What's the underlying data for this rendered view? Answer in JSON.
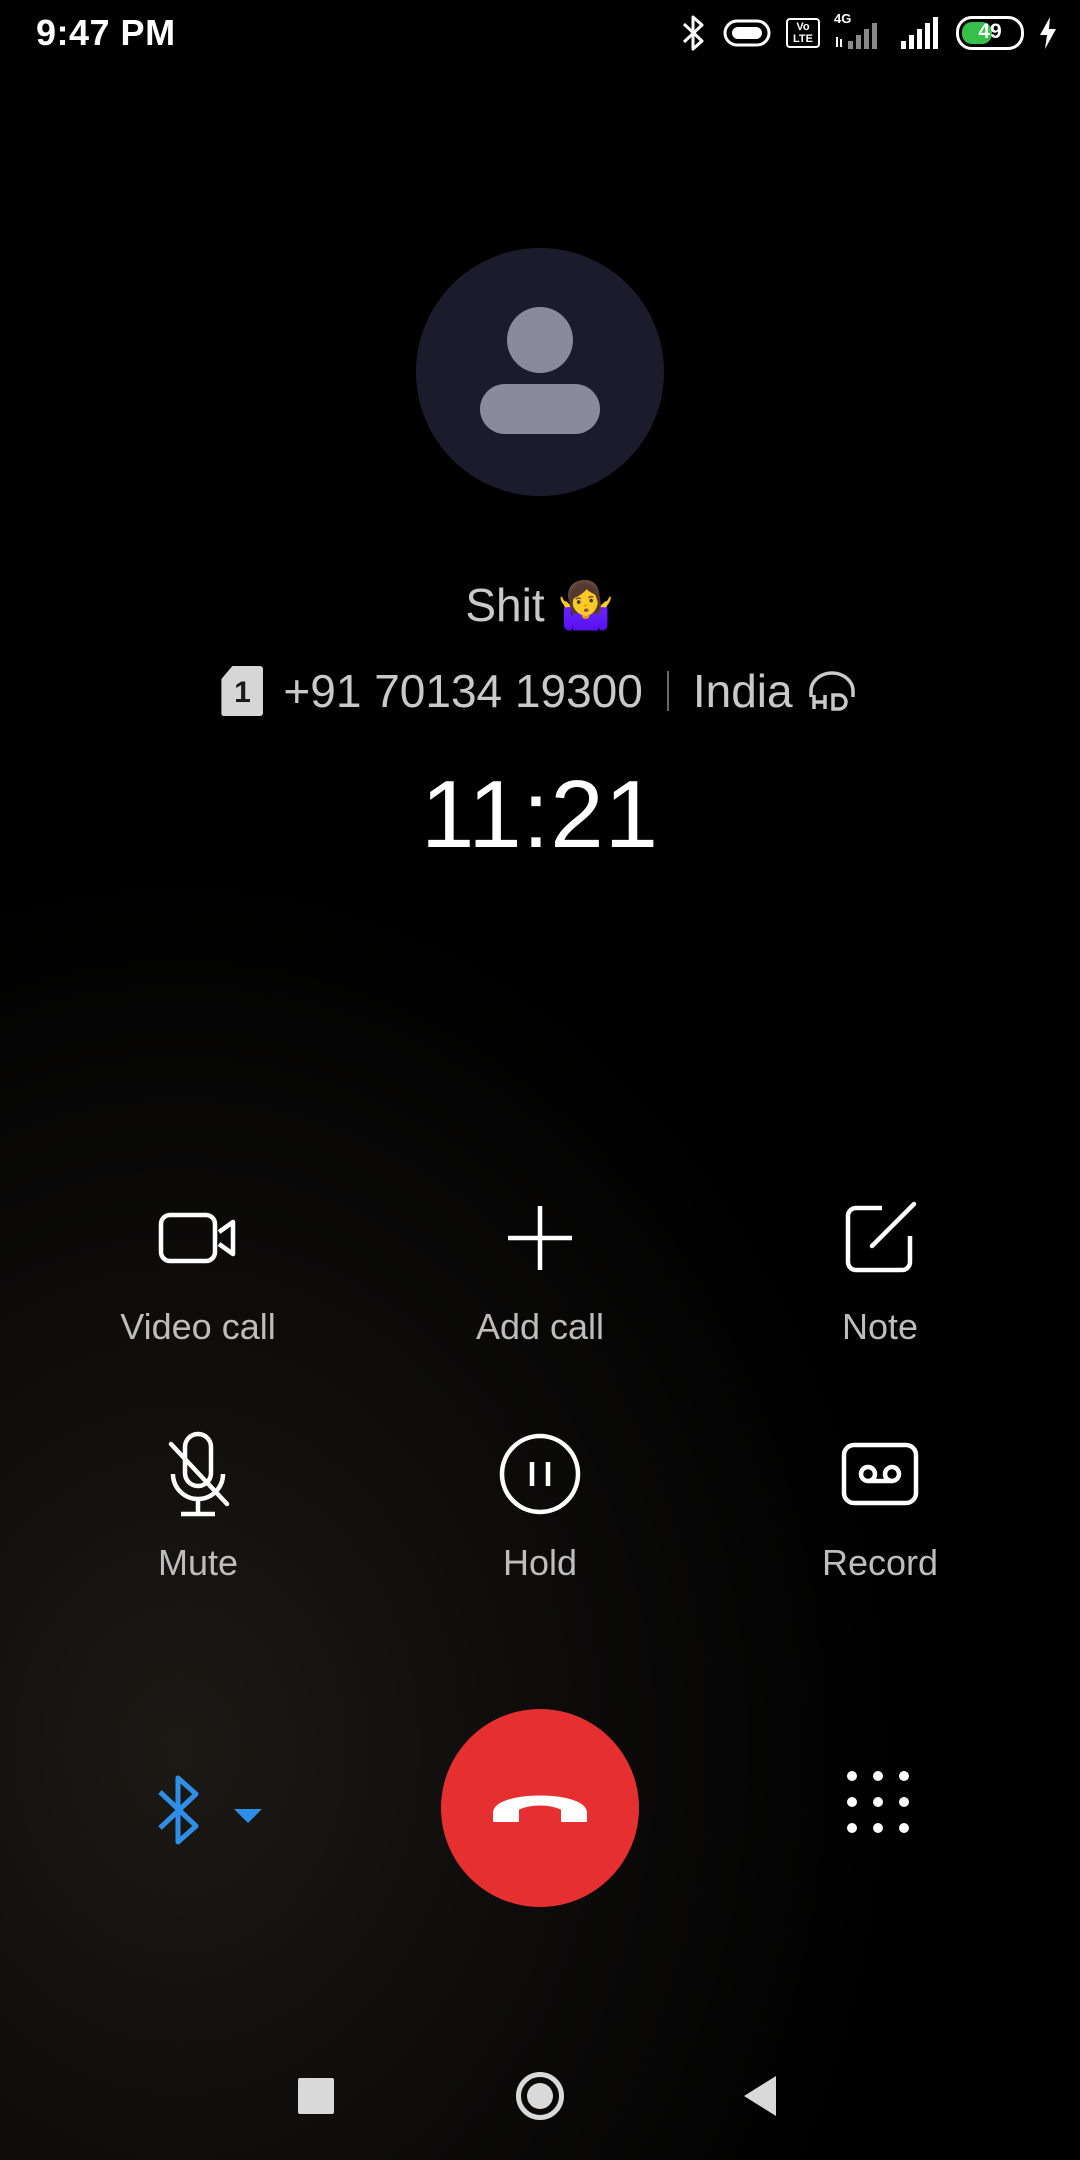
{
  "status_bar": {
    "time": "9:47 PM",
    "volte_label_top": "Vo",
    "volte_label_bottom": "LTE",
    "network_type": "4G",
    "battery_level": "49",
    "battery_fraction": 0.49,
    "icons": [
      "bluetooth-icon",
      "vibrate-icon",
      "volte-icon",
      "signal-4g-icon",
      "signal-icon",
      "battery-icon",
      "charging-icon"
    ]
  },
  "contact": {
    "name": "Shit 🤷‍♀️",
    "sim_slot": "1",
    "number": "+91 70134 19300",
    "location": "India",
    "hd_badge_icon": "hd-voice-icon"
  },
  "call": {
    "timer": "11:21"
  },
  "controls": {
    "video_call": "Video call",
    "add_call": "Add call",
    "note": "Note",
    "mute": "Mute",
    "hold": "Hold",
    "record": "Record"
  },
  "colors": {
    "end_call": "#e52f30",
    "bluetooth_accent": "#2f8fe8",
    "battery_fill": "#36c04a",
    "avatar_bg": "#1b1b2c"
  }
}
